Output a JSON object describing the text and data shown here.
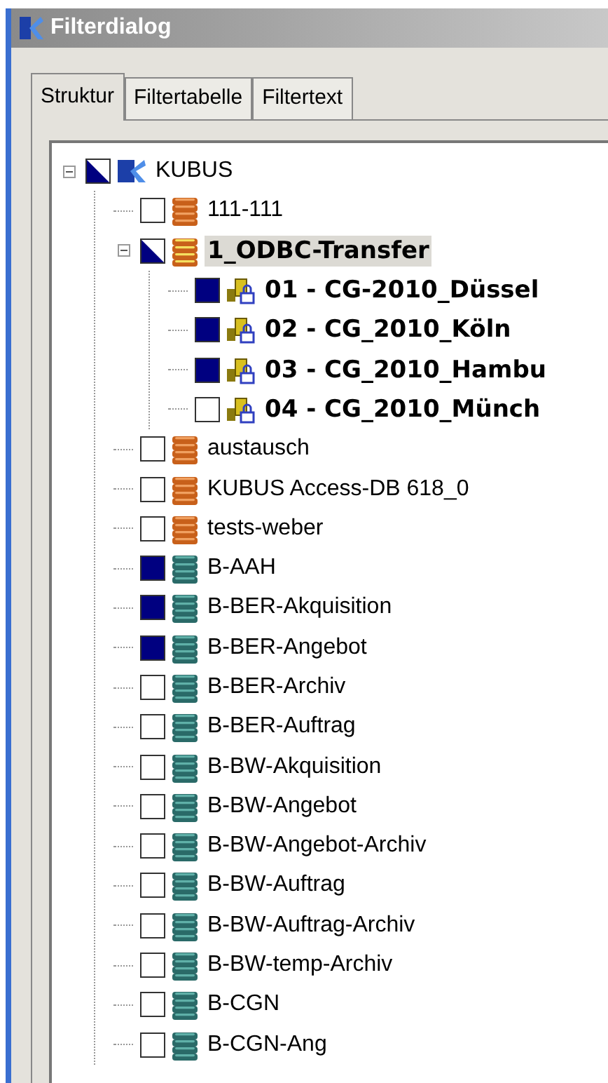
{
  "window": {
    "title": "Filterdialog"
  },
  "tabs": [
    {
      "label": "Struktur",
      "selected": true
    },
    {
      "label": "Filtertabelle",
      "selected": false
    },
    {
      "label": "Filtertext",
      "selected": false
    }
  ],
  "tree": [
    {
      "label": "KUBUS",
      "kind": "root",
      "checked": false,
      "mixed": true,
      "expanded": true,
      "selected": false,
      "children": [
        {
          "label": "111-111",
          "kind": "database",
          "checked": false,
          "mixed": false,
          "selected": false
        },
        {
          "label": "1_ODBC-Transfer",
          "kind": "transfer",
          "checked": false,
          "mixed": true,
          "expanded": true,
          "selected": true,
          "children": [
            {
              "label": "01 - CG-2010_Düssel",
              "kind": "connection",
              "checked": true,
              "mixed": false,
              "selected": false
            },
            {
              "label": "02 - CG_2010_Köln",
              "kind": "connection",
              "checked": true,
              "mixed": false,
              "selected": false
            },
            {
              "label": "03 - CG_2010_Hambu",
              "kind": "connection",
              "checked": true,
              "mixed": false,
              "selected": false
            },
            {
              "label": "04 - CG_2010_Münch",
              "kind": "connection",
              "checked": false,
              "mixed": false,
              "selected": false
            }
          ]
        },
        {
          "label": "austausch",
          "kind": "database",
          "checked": false,
          "mixed": false,
          "selected": false
        },
        {
          "label": "KUBUS Access-DB 618_0",
          "kind": "database",
          "checked": false,
          "mixed": false,
          "selected": false
        },
        {
          "label": "tests-weber",
          "kind": "database",
          "checked": false,
          "mixed": false,
          "selected": false
        },
        {
          "label": "B-AAH",
          "kind": "branch",
          "checked": true,
          "mixed": false,
          "selected": false
        },
        {
          "label": "B-BER-Akquisition",
          "kind": "branch",
          "checked": true,
          "mixed": false,
          "selected": false
        },
        {
          "label": "B-BER-Angebot",
          "kind": "branch",
          "checked": true,
          "mixed": false,
          "selected": false
        },
        {
          "label": "B-BER-Archiv",
          "kind": "branch",
          "checked": false,
          "mixed": false,
          "selected": false
        },
        {
          "label": "B-BER-Auftrag",
          "kind": "branch",
          "checked": false,
          "mixed": false,
          "selected": false
        },
        {
          "label": "B-BW-Akquisition",
          "kind": "branch",
          "checked": false,
          "mixed": false,
          "selected": false
        },
        {
          "label": "B-BW-Angebot",
          "kind": "branch",
          "checked": false,
          "mixed": false,
          "selected": false
        },
        {
          "label": "B-BW-Angebot-Archiv",
          "kind": "branch",
          "checked": false,
          "mixed": false,
          "selected": false
        },
        {
          "label": "B-BW-Auftrag",
          "kind": "branch",
          "checked": false,
          "mixed": false,
          "selected": false
        },
        {
          "label": "B-BW-Auftrag-Archiv",
          "kind": "branch",
          "checked": false,
          "mixed": false,
          "selected": false
        },
        {
          "label": "B-BW-temp-Archiv",
          "kind": "branch",
          "checked": false,
          "mixed": false,
          "selected": false
        },
        {
          "label": "B-CGN",
          "kind": "branch",
          "checked": false,
          "mixed": false,
          "selected": false
        },
        {
          "label": "B-CGN-Ang",
          "kind": "branch",
          "checked": false,
          "mixed": false,
          "selected": false
        }
      ]
    }
  ]
}
